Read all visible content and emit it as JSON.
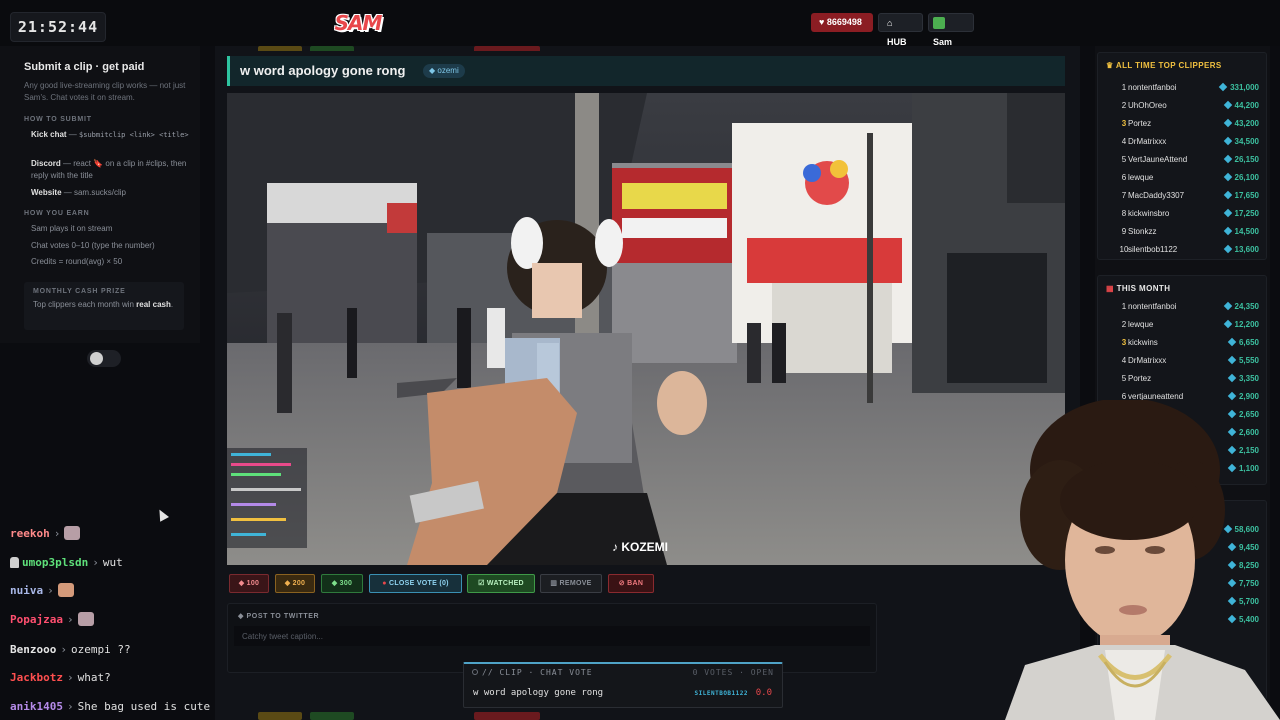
{
  "clock": "21:52:44",
  "logo": "SAM SUCKS",
  "header": {
    "gems": "8669498",
    "hub": "HUB",
    "user": "Sam"
  },
  "sidebar": {
    "title": "Submit a clip · get paid",
    "desc": "Any good live-streaming clip works — not just Sam's. Chat votes it on stream.",
    "how_submit": "HOW TO SUBMIT",
    "kick_label": "Kick chat",
    "kick_sep": " — ",
    "kick_cmd": "$submitclip <link> <title>",
    "discord_label": "Discord",
    "discord_text": " — react 🔖 on a clip in #clips, then reply with the title",
    "website_label": "Website",
    "website_text": " — sam.sucks/clip",
    "how_earn": "HOW YOU EARN",
    "earn": [
      "Sam plays it on stream",
      "Chat votes 0–10 (type the number)",
      "Credits = round(avg) × 50"
    ],
    "prize_title": "MONTHLY CASH PRIZE",
    "prize_text": "Top clippers each month win ",
    "prize_bold": "real cash",
    "prize_end": "."
  },
  "chat": [
    {
      "user": "reekoh",
      "color": "#ff8a8a",
      "badge": false,
      "emote": "cat",
      "msg": ""
    },
    {
      "user": "umop3plsdn",
      "color": "#5ee07a",
      "badge": true,
      "emote": "",
      "msg": "wut"
    },
    {
      "user": "nuiva",
      "color": "#a9b8e8",
      "badge": false,
      "emote": "face",
      "msg": ""
    },
    {
      "user": "Popajzaa",
      "color": "#ff4f6f",
      "badge": false,
      "emote": "cat",
      "msg": ""
    },
    {
      "user": "Benzooo",
      "color": "#e6e6e6",
      "badge": false,
      "emote": "",
      "msg": "ozempi ??"
    },
    {
      "user": "Jackbotz",
      "color": "#ff4f4f",
      "badge": false,
      "emote": "",
      "msg": "what?"
    },
    {
      "user": "anik1405",
      "color": "#b48ae8",
      "badge": false,
      "emote": "",
      "msg": "She bag used is cute"
    }
  ],
  "clip": {
    "title": "w word apology gone rong",
    "tag": "ozemi",
    "watermark": "KOZEMI"
  },
  "controls": {
    "v100": "100",
    "v200": "200",
    "v300": "300",
    "close_vote": "CLOSE VOTE (0)",
    "watched": "WATCHED",
    "remove": "REMOVE",
    "ban": "BAN"
  },
  "tweet": {
    "header": "POST TO TWITTER",
    "placeholder": "Catchy tweet caption..."
  },
  "vote_overlay": {
    "header": "// CLIP · CHAT VOTE",
    "status": "0 VOTES · OPEN",
    "title": "w word apology gone rong",
    "user": "SILENTBOB1122",
    "score": "0.0"
  },
  "leaderboard_all": {
    "title": "ALL TIME TOP CLIPPERS",
    "rows": [
      {
        "rank": "1",
        "name": "nontentfanboi",
        "score": "331,000"
      },
      {
        "rank": "2",
        "name": "UhOhOreo",
        "score": "44,200"
      },
      {
        "rank": "3",
        "name": "Portez",
        "score": "43,200"
      },
      {
        "rank": "4",
        "name": "DrMatrixxx",
        "score": "34,500"
      },
      {
        "rank": "5",
        "name": "VertJauneAttend",
        "score": "26,150"
      },
      {
        "rank": "6",
        "name": "lewque",
        "score": "26,100"
      },
      {
        "rank": "7",
        "name": "MacDaddy3307",
        "score": "17,650"
      },
      {
        "rank": "8",
        "name": "kickwinsbro",
        "score": "17,250"
      },
      {
        "rank": "9",
        "name": "Stonkzz",
        "score": "14,500"
      },
      {
        "rank": "10",
        "name": "silentbob1122",
        "score": "13,600"
      }
    ]
  },
  "leaderboard_month": {
    "title": "THIS MONTH",
    "rows": [
      {
        "rank": "1",
        "name": "nontentfanboi",
        "score": "24,350"
      },
      {
        "rank": "2",
        "name": "lewque",
        "score": "12,200"
      },
      {
        "rank": "3",
        "name": "kickwins",
        "score": "6,650"
      },
      {
        "rank": "4",
        "name": "DrMatrixxx",
        "score": "5,550"
      },
      {
        "rank": "5",
        "name": "Portez",
        "score": "3,350"
      },
      {
        "rank": "6",
        "name": "vertjauneattend",
        "score": "2,900"
      },
      {
        "rank": "",
        "name": "",
        "score": "2,650"
      },
      {
        "rank": "",
        "name": "",
        "score": "2,600"
      },
      {
        "rank": "",
        "name": "",
        "score": "2,150"
      },
      {
        "rank": "",
        "name": "",
        "score": "1,100"
      }
    ]
  },
  "leaderboard_partial": [
    "58,600",
    "9,450",
    "8,250",
    "7,750",
    "5,700",
    "5,400"
  ]
}
